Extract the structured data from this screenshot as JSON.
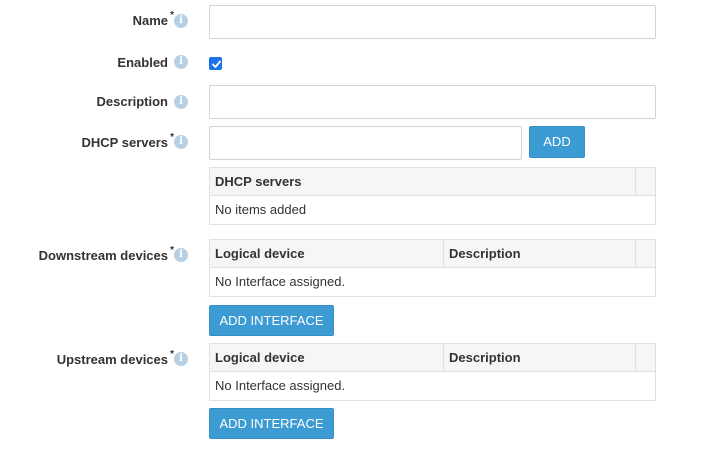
{
  "fields": {
    "name": {
      "label": "Name",
      "required_mark": "*",
      "value": ""
    },
    "enabled": {
      "label": "Enabled",
      "checked": true
    },
    "description": {
      "label": "Description",
      "value": ""
    },
    "dhcp_servers": {
      "label": "DHCP servers",
      "required_mark": "*",
      "value": "",
      "add_label": "ADD"
    },
    "downstream": {
      "label": "Downstream devices",
      "required_mark": "*"
    },
    "upstream": {
      "label": "Upstream devices",
      "required_mark": "*"
    }
  },
  "info_icon_glyph": "i",
  "dhcp_table": {
    "header": "DHCP servers",
    "empty_text": "No items added"
  },
  "downstream_table": {
    "headers": [
      "Logical device",
      "Description"
    ],
    "empty_text": "No Interface assigned.",
    "button_label": "ADD INTERFACE"
  },
  "upstream_table": {
    "headers": [
      "Logical device",
      "Description"
    ],
    "empty_text": "No Interface assigned.",
    "button_label": "ADD INTERFACE"
  },
  "colors": {
    "button": "#3c9bd3",
    "checkbox": "#1a73e8",
    "info_icon": "#b7cfe2",
    "table_header_bg": "#f5f6f6",
    "border": "#cfd4d8"
  }
}
